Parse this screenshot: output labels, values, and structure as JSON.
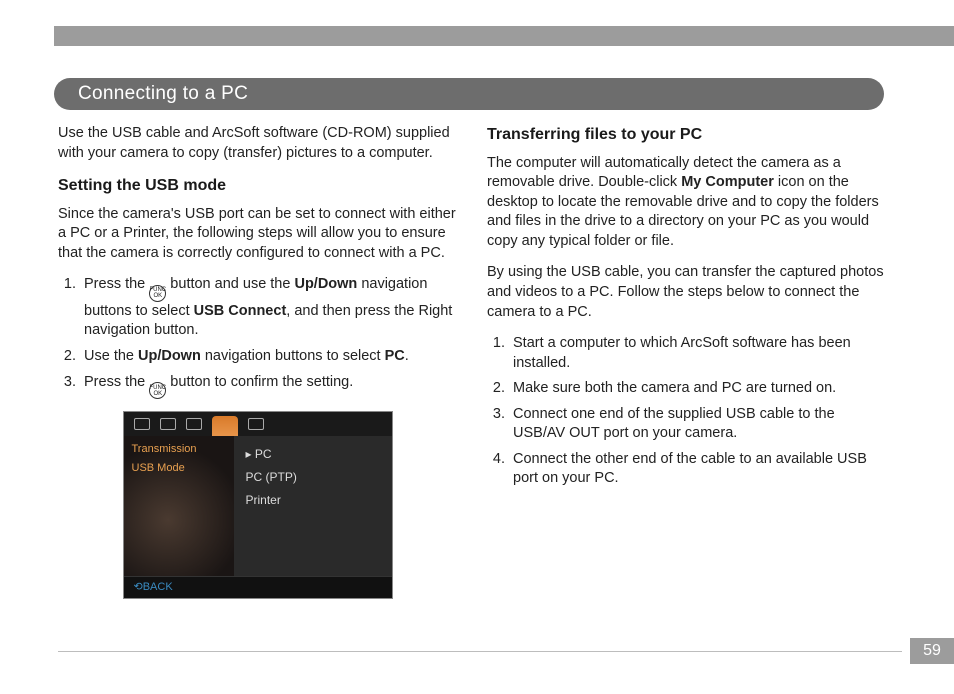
{
  "page": {
    "title": "Connecting to a PC",
    "pageNumber": "59"
  },
  "left": {
    "intro": "Use the USB cable and ArcSoft software (CD-ROM) supplied with your camera to copy (transfer) pictures to a computer.",
    "h1": "Setting the USB mode",
    "p1": "Since the camera's USB port can be set to connect with either a PC or a Printer, the following steps will allow you to ensure that the camera is correctly configured to connect with a PC.",
    "step1_a": "Press the ",
    "step1_b": " button and use the ",
    "step1_updown": "Up/Down",
    "step1_c": " navigation buttons to select ",
    "step1_usb": "USB Connect",
    "step1_d": ", and then press the Right navigation button.",
    "step2_a": "Use the ",
    "step2_updown": "Up/Down",
    "step2_b": " navigation buttons to select ",
    "step2_pc": "PC",
    "step2_c": ".",
    "step3_a": "Press the ",
    "step3_b": " button to confirm the setting."
  },
  "cam": {
    "transmission": "Transmission",
    "usbmode": "USB Mode",
    "opt1": "PC",
    "opt2": "PC (PTP)",
    "opt3": "Printer",
    "back": "⟲BACK"
  },
  "right": {
    "h1": "Transferring files to your PC",
    "p1a": "The computer will automatically detect the camera as a removable drive. Double-click ",
    "p1_my": "My Computer",
    "p1b": " icon on the desktop to locate the removable drive and to copy the folders and files in the drive to a directory on your PC as you would copy any typical folder or file.",
    "p2": "By using the USB cable, you can transfer the captured photos and videos to a PC. Follow the steps below to connect the camera to a PC.",
    "s1": "Start a computer to which ArcSoft software has been installed.",
    "s2": "Make sure both the camera and PC are turned on.",
    "s3": "Connect one end of the supplied USB cable to the USB/AV OUT port on your camera.",
    "s4": "Connect the other end of the cable to an available USB port on your PC."
  }
}
